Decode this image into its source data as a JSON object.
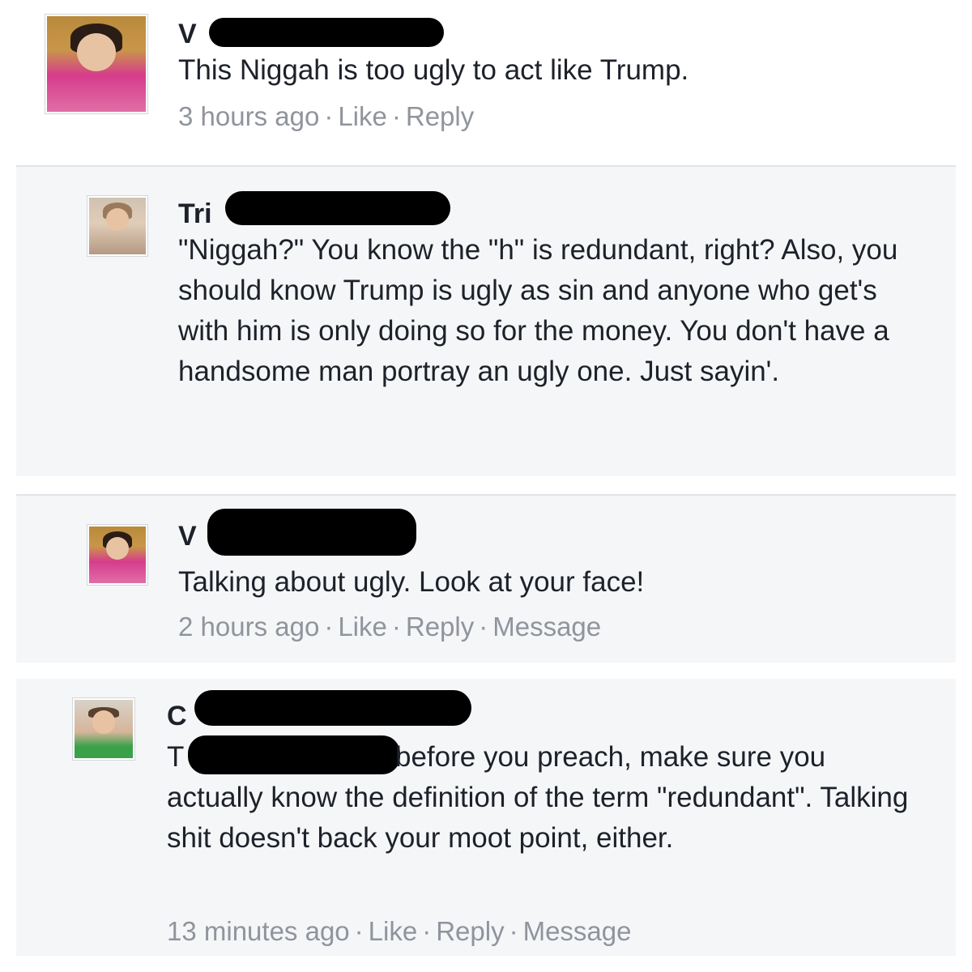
{
  "comments": [
    {
      "name": "V",
      "text": "This Niggah is too ugly to act like Trump.",
      "time": "3 hours ago",
      "actions": [
        "Like",
        "Reply"
      ]
    },
    {
      "name": "Tri",
      "text": "\"Niggah?\" You know the \"h\" is redundant, right? Also, you should know Trump is ugly as sin and anyone who get's with him is only doing so for the money. You don't have a handsome man portray an ugly one. Just sayin'."
    },
    {
      "name": "V",
      "text": "Talking about ugly. Look at your face!",
      "time": "2 hours ago",
      "actions": [
        "Like",
        "Reply",
        "Message"
      ]
    },
    {
      "name": "C",
      "text_prefix": "T",
      "text": "before you preach, make sure you actually know the definition of the term \"redundant\". Talking shit doesn't back your moot point, either.",
      "time": "13 minutes ago",
      "actions": [
        "Like",
        "Reply",
        "Message"
      ]
    }
  ],
  "separator": "·"
}
